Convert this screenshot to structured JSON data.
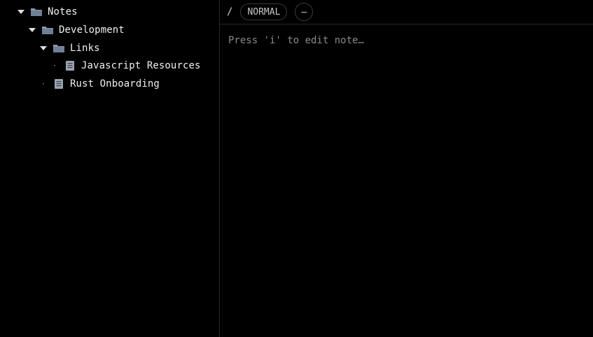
{
  "tree": {
    "root": {
      "label": "Notes",
      "icon": "folder-icon",
      "expanded": true
    },
    "development": {
      "label": "Development",
      "icon": "folder-icon",
      "expanded": true
    },
    "links": {
      "label": "Links",
      "icon": "folder-icon",
      "expanded": true
    },
    "javascript": {
      "label": "Javascript Resources",
      "icon": "note-icon"
    },
    "rust": {
      "label": "Rust Onboarding",
      "icon": "note-icon"
    }
  },
  "toolbar": {
    "path": "/",
    "mode": "NORMAL",
    "dash_label": "–"
  },
  "editor": {
    "placeholder": "Press 'i' to edit note…"
  },
  "colors": {
    "background": "#000000",
    "border": "#2a2a2a",
    "folder": "#8a9aae",
    "note": "#9aa4b0"
  }
}
